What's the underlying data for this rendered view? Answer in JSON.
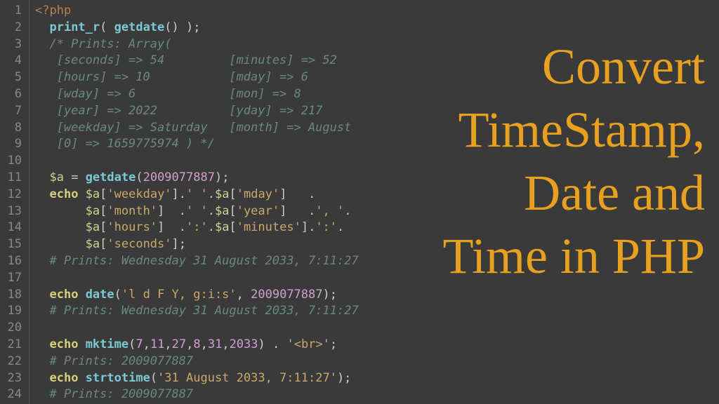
{
  "title": {
    "line1": "Convert",
    "line2": "TimeStamp,",
    "line3": "Date and",
    "line4": "Time in PHP"
  },
  "gutter": {
    "start": 1,
    "end": 24
  },
  "code": {
    "l1": {
      "a": "<?php"
    },
    "l2": {
      "a": "  ",
      "b": "print_r",
      "c": "( ",
      "d": "getdate",
      "e": "() );"
    },
    "l3": {
      "a": "  /* Prints: Array("
    },
    "l4": {
      "a": "   [seconds] => 54         [minutes] => 52"
    },
    "l5": {
      "a": "   [hours] => 10           [mday] => 6"
    },
    "l6": {
      "a": "   [wday] => 6             [mon] => 8"
    },
    "l7": {
      "a": "   [year] => 2022          [yday] => 217"
    },
    "l8": {
      "a": "   [weekday] => Saturday   [month] => August"
    },
    "l9": {
      "a": "   [0] => 1659775974 ) */"
    },
    "l10": {
      "a": ""
    },
    "l11": {
      "a": "  ",
      "b": "$a",
      "c": " = ",
      "d": "getdate",
      "e": "(",
      "f": "2009077887",
      "g": ");"
    },
    "l12": {
      "a": "  ",
      "b": "echo",
      "c": " ",
      "d": "$a",
      "e": "[",
      "f": "'weekday'",
      "g": "].",
      "h": "' '",
      "i": ".",
      "j": "$a",
      "k": "[",
      "l": "'mday'",
      "m": "]   ."
    },
    "l13": {
      "a": "       ",
      "b": "$a",
      "c": "[",
      "d": "'month'",
      "e": "]  .",
      "f": "' '",
      "g": ".",
      "h": "$a",
      "i": "[",
      "j": "'year'",
      "k": "]   .",
      "l": "', '",
      "m": "."
    },
    "l14": {
      "a": "       ",
      "b": "$a",
      "c": "[",
      "d": "'hours'",
      "e": "]  .",
      "f": "':'",
      "g": ".",
      "h": "$a",
      "i": "[",
      "j": "'minutes'",
      "k": "].",
      "l": "':'",
      "m": "."
    },
    "l15": {
      "a": "       ",
      "b": "$a",
      "c": "[",
      "d": "'seconds'",
      "e": "];"
    },
    "l16": {
      "a": "  # Prints: Wednesday 31 August 2033, 7:11:27"
    },
    "l17": {
      "a": ""
    },
    "l18": {
      "a": "  ",
      "b": "echo",
      "c": " ",
      "d": "date",
      "e": "(",
      "f": "'l d F Y, g:i:s'",
      "g": ", ",
      "h": "2009077887",
      "i": ");"
    },
    "l19": {
      "a": "  # Prints: Wednesday 31 August 2033, 7:11:27"
    },
    "l20": {
      "a": ""
    },
    "l21": {
      "a": "  ",
      "b": "echo",
      "c": " ",
      "d": "mktime",
      "e": "(",
      "f": "7",
      "g": ",",
      "h": "11",
      "i": ",",
      "j": "27",
      "k": ",",
      "l": "8",
      "m": ",",
      "n": "31",
      "o": ",",
      "p": "2033",
      "q": ") . ",
      "r": "'<br>'",
      "s": ";"
    },
    "l22": {
      "a": "  # Prints: 2009077887"
    },
    "l23": {
      "a": "  ",
      "b": "echo",
      "c": " ",
      "d": "strtotime",
      "e": "(",
      "f": "'31 August 2033, 7:11:27'",
      "g": ");"
    },
    "l24": {
      "a": "  # Prints: 2009077887"
    }
  }
}
